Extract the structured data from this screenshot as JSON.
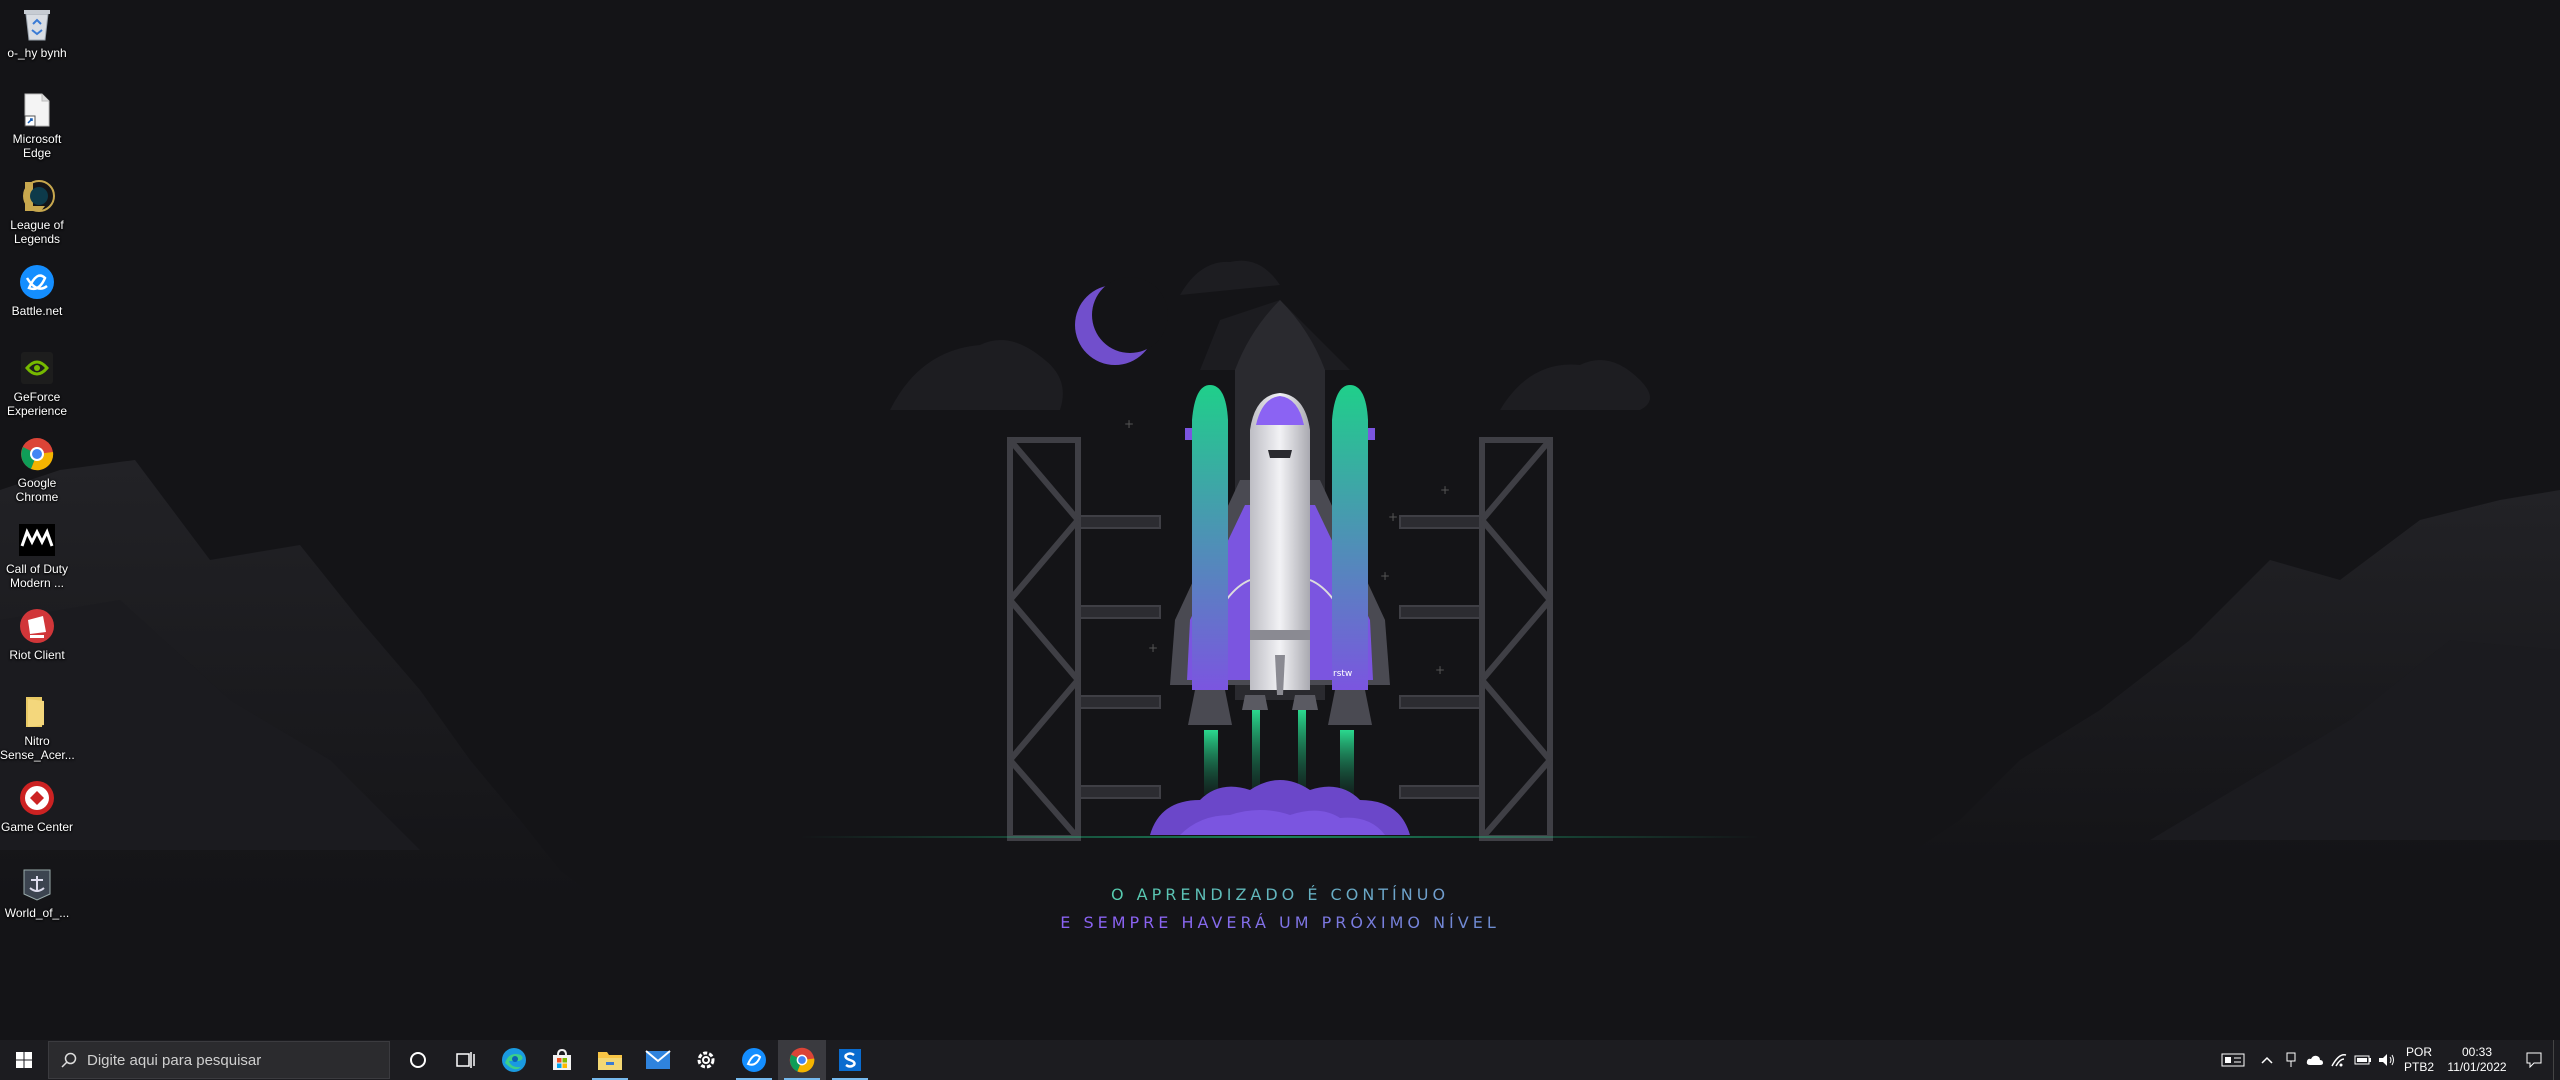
{
  "desktop": {
    "icons": [
      {
        "label": "o-_hy bynh",
        "icon": "recycle-bin-icon"
      },
      {
        "label": "Microsoft Edge",
        "icon": "file-shortcut-icon"
      },
      {
        "label": "League of Legends",
        "icon": "league-of-legends-icon"
      },
      {
        "label": "Battle.net",
        "icon": "battlenet-icon"
      },
      {
        "label": "GeForce Experience",
        "icon": "geforce-icon"
      },
      {
        "label": "Google Chrome",
        "icon": "chrome-icon"
      },
      {
        "label": "Call of Duty Modern ...",
        "icon": "call-of-duty-icon"
      },
      {
        "label": "Riot Client",
        "icon": "riot-client-icon"
      },
      {
        "label": "Nitro Sense_Acer...",
        "icon": "folder-icon"
      },
      {
        "label": "Game Center",
        "icon": "game-center-icon"
      },
      {
        "label": "World_of_...",
        "icon": "world-of-warships-icon"
      }
    ]
  },
  "wallpaper": {
    "line1": "O APRENDIZADO É CONTÍNUO",
    "line2": "E SEMPRE HAVERÁ UM PRÓXIMO NÍVEL",
    "rocket_badge": "rstw"
  },
  "taskbar": {
    "search_placeholder": "Digite aqui para pesquisar",
    "pinned": [
      "edge-icon",
      "store-icon",
      "file-explorer-icon",
      "mail-icon",
      "settings-icon",
      "battlenet-icon",
      "chrome-icon",
      "app-s-icon"
    ],
    "tray": {
      "lang_top": "POR",
      "lang_bottom": "PTB2",
      "time": "00:33",
      "date": "11/01/2022"
    }
  },
  "colors": {
    "background": "#141417",
    "accent_green": "#1fcf8a",
    "accent_purple": "#7b55e0",
    "taskbar": "#1c1c20"
  }
}
